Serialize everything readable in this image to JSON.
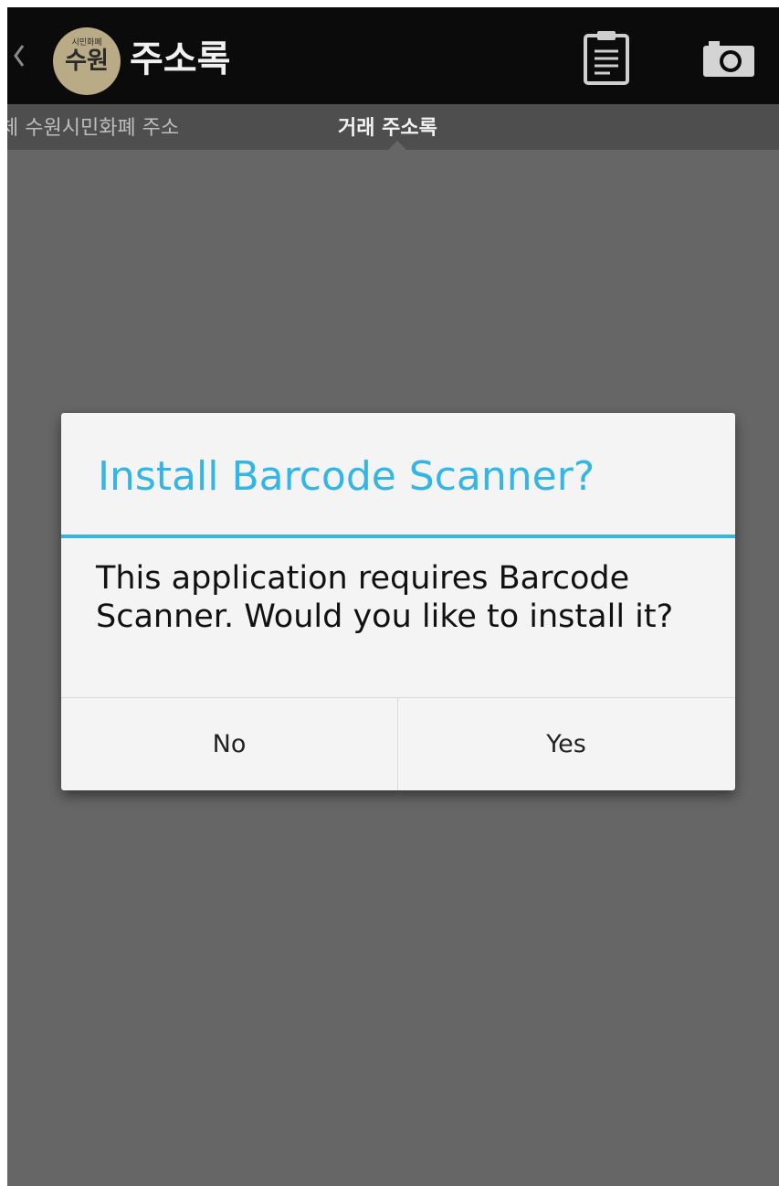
{
  "action_bar": {
    "logo_small_text": "시민화폐",
    "logo_main_text": "수원",
    "title": "주소록",
    "icons": {
      "back": "chevron-left-icon",
      "clipboard": "clipboard-icon",
      "camera": "camera-icon"
    }
  },
  "tabs": [
    {
      "label": "체 수원시민화폐 주소",
      "selected": false
    },
    {
      "label": "거래 주소록",
      "selected": true
    }
  ],
  "dialog": {
    "title": "Install Barcode Scanner?",
    "message": "This application requires Barcode Scanner. Would you like to install it?",
    "buttons": {
      "no": "No",
      "yes": "Yes"
    }
  },
  "colors": {
    "accent": "#33b5e5",
    "action_bar": "#0b0b0b",
    "dim_background": "#666666",
    "dialog_background": "#f4f4f4"
  }
}
